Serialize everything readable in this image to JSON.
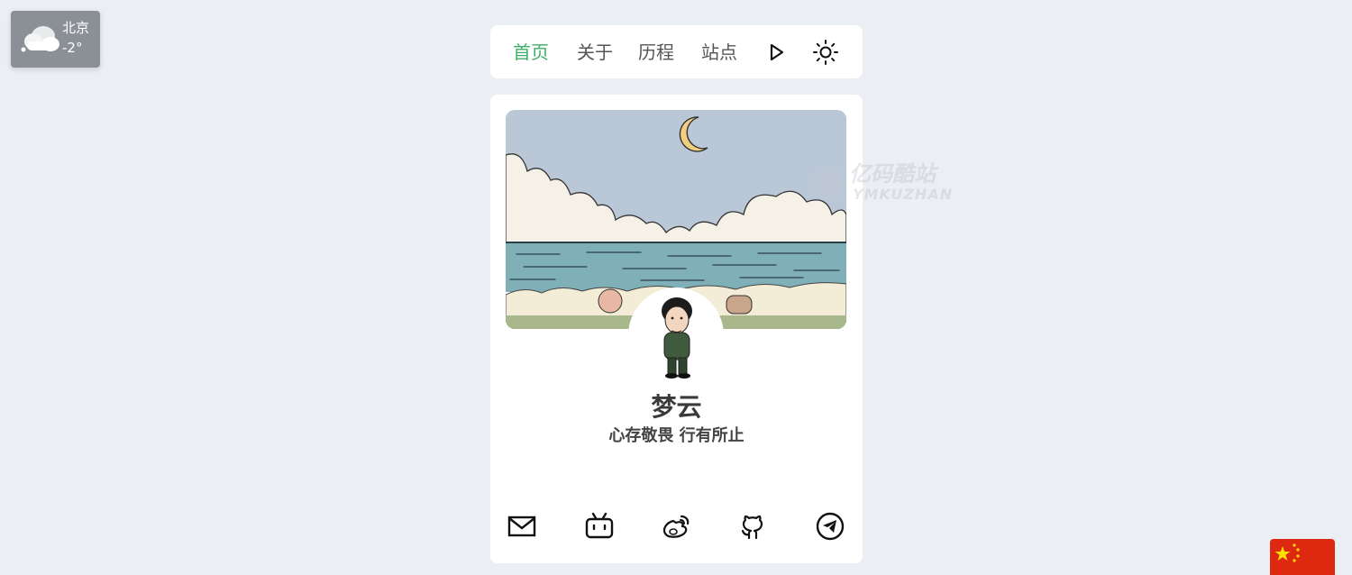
{
  "weather": {
    "icon": "cloudy-icon",
    "city": "北京",
    "temp": "-2°"
  },
  "nav": {
    "items": [
      {
        "label": "首页",
        "active": true
      },
      {
        "label": "关于",
        "active": false
      },
      {
        "label": "历程",
        "active": false
      },
      {
        "label": "站点",
        "active": false
      }
    ],
    "icons": [
      "play-icon",
      "sun-icon"
    ]
  },
  "profile": {
    "name": "梦云",
    "motto": "心存敬畏 行有所止"
  },
  "social": [
    "mail-icon",
    "bilibili-icon",
    "weibo-icon",
    "github-icon",
    "telegram-icon"
  ],
  "watermark": {
    "title": "亿码酷站",
    "subtitle": "YMKUZHAN"
  },
  "colors": {
    "accent": "#3eaf6a",
    "background": "#ebeef2",
    "flag": "#de2910",
    "flag_star": "#ffde00"
  }
}
